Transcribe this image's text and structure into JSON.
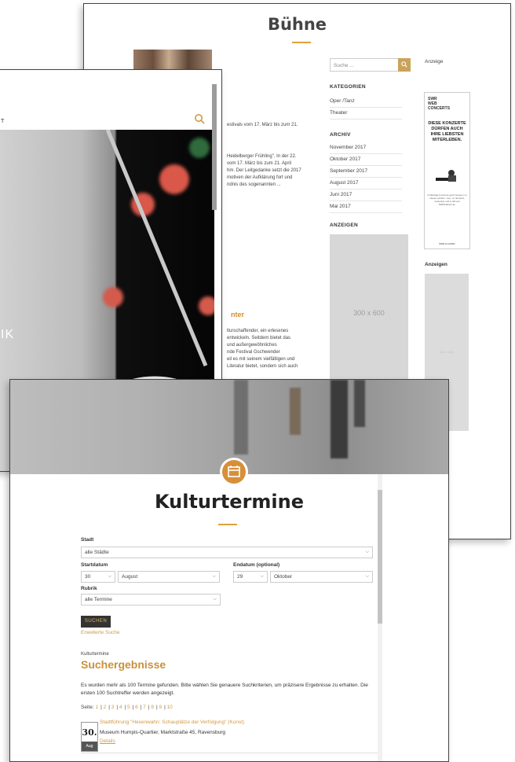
{
  "buehne": {
    "title": "Bühne",
    "search_placeholder": "Suche ...",
    "anzeige": "Anzeige",
    "kategorien_head": "KATEGORIEN",
    "kategorien": [
      "Oper /Tanz",
      "Theater"
    ],
    "archiv_head": "ARCHIV",
    "archiv": [
      "November 2017",
      "Oktober 2017",
      "September 2017",
      "August 2017",
      "Juni 2017",
      "Mai 2017"
    ],
    "anzeigen_head": "ANZEIGEN",
    "ad_300": "300 x 600",
    "anzeigen_right": "Anzeigen",
    "ad_small": "160 x 600",
    "swr": {
      "logo1": "SWR",
      "logo2": "WEB",
      "logo3": "CONCERTS",
      "headline": "DIESE KONZERTE DÜRFEN AUCH IHRE LIEBSTEN MITERLEBEN.",
      "small": "Großartige Konzerte ganz bequem zu Hause erleben. Live, on demand, kostenlos und in HD auf SWRClassic.de.",
      "foot": "SWR CLASSIC"
    },
    "article_line1": "estivals vom 17. März bis zum 21.",
    "article_para": [
      "Heidelberger Frühling\". In der 22.",
      "vom 17. März bis zum 21. April",
      "hm. Der Leitgedanke setzt die 2017",
      "motiven der Aufklärung fort und",
      "ndnis des sogenannten ..."
    ],
    "section_head": "nter",
    "section_para": [
      "lturschaffender, ein erlesenes",
      "entwickeln. Seitdem bietet das",
      "und außergewöhnliches",
      "nde Festival Gschwender",
      "eil es mit seinem vielfältigen und",
      "Literatur bietet, sondern sich auch"
    ]
  },
  "image_window": {
    "header_text": "T",
    "overlay_text": "IK"
  },
  "kultur": {
    "title": "Kulturtermine",
    "stadt_label": "Stadt",
    "stadt_value": "alle Städte",
    "startdatum_label": "Startdatum",
    "start_day": "30",
    "start_month": "August",
    "enddatum_label": "Endatum (optional)",
    "end_day": "29",
    "end_month": "Oktober",
    "rubrik_label": "Rubrik",
    "rubrik_value": "alle Termine",
    "search_button": "SUCHEN",
    "ext_search": "Erweiterte Suche",
    "kicker": "Kulturtermine",
    "results_title": "Suchergebnisse",
    "info": "Es wurden mehr als 100 Termine gefunden. Bitte wählen Sie genauere Suchkriterien, um präzisere Ergebnisse zu erhalten. Die ersten 100 Suchtreffer werden angezeigt.",
    "pages_label": "Seite:",
    "pages": [
      "1",
      "2",
      "3",
      "4",
      "5",
      "6",
      "7",
      "8",
      "9",
      "10"
    ],
    "event": {
      "day": "30.",
      "month": "Aug",
      "title": "Stadtführung \"Hexenwahn: Schauplätze der Verfolgung\" (Kunst)",
      "location": "Museum Humpis-Quartier, Marktstraße 45, Ravensburg",
      "details": "Details"
    }
  },
  "colors": {
    "accent": "#d6903a",
    "link": "#d39a43",
    "dark_button": "#333333"
  }
}
